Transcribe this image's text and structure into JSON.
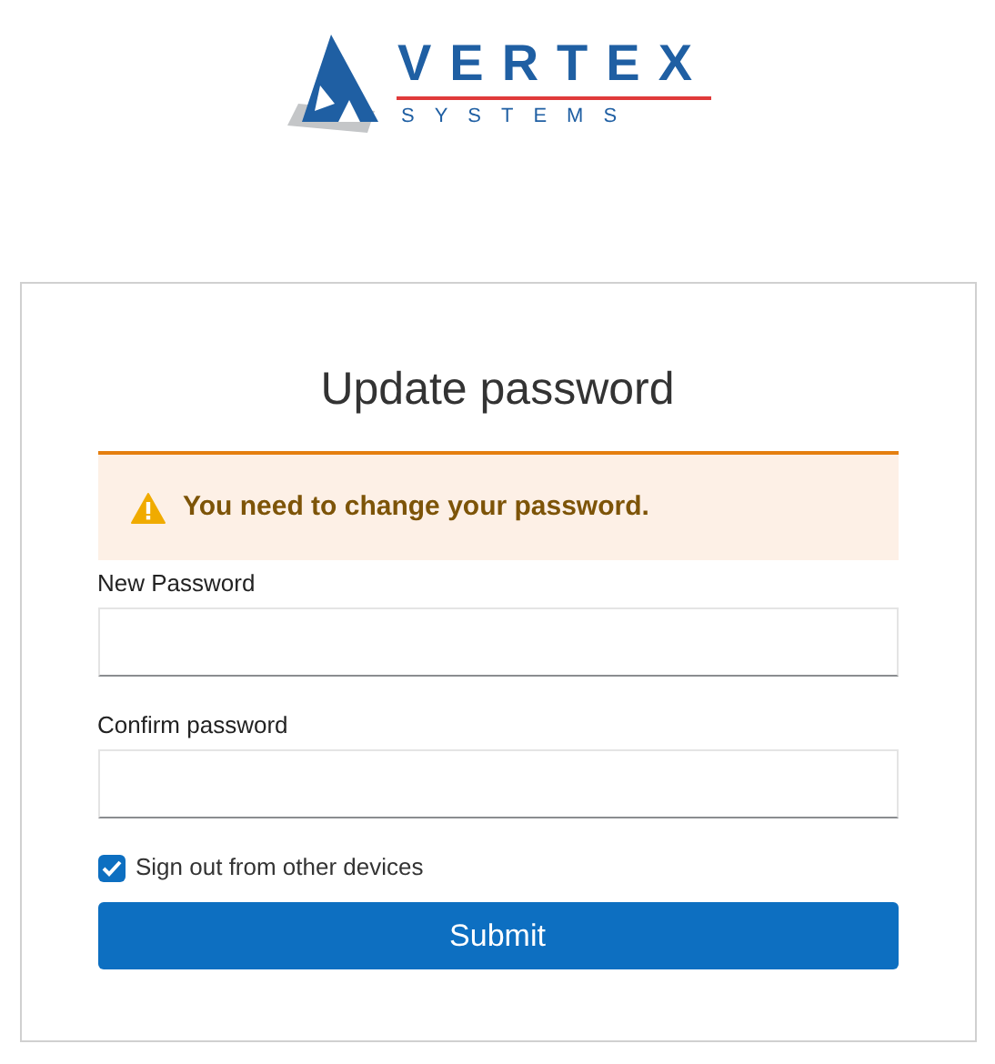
{
  "logo": {
    "name": "VERTEX",
    "tagline": "SYSTEMS"
  },
  "title": "Update password",
  "alert": {
    "message": "You need to change your password."
  },
  "fields": [
    {
      "label": "New Password"
    },
    {
      "label": "Confirm password"
    }
  ],
  "sign_out_others": {
    "label": "Sign out from other devices",
    "checked": true
  },
  "submit": "Submit"
}
